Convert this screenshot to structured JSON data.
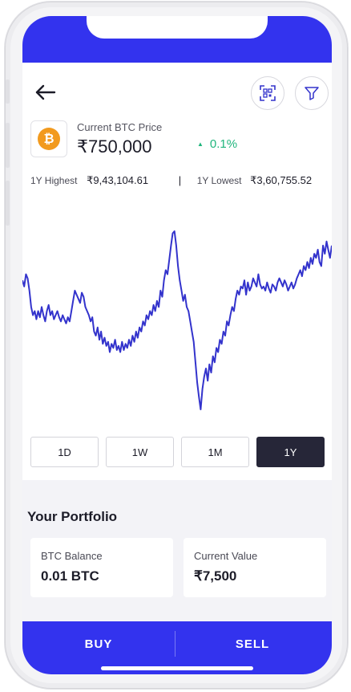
{
  "header": {
    "back_icon": "arrow-left-icon",
    "scan_icon": "qr-scan-icon",
    "filter_icon": "filter-icon"
  },
  "price": {
    "coin_symbol": "₿",
    "label": "Current BTC Price",
    "value": "₹750,000",
    "change": "0.1%",
    "change_color": "#1fb57c"
  },
  "stats": {
    "high_label": "1Y Highest",
    "high_value": "₹9,43,104.61",
    "separator": "|",
    "low_label": "1Y Lowest",
    "low_value": "₹3,60,755.52"
  },
  "chart_data": {
    "type": "line",
    "title": "",
    "xlabel": "",
    "ylabel": "",
    "grid": false,
    "color": "#3333cc",
    "values": [
      75,
      72,
      78,
      76,
      70,
      62,
      58,
      60,
      56,
      60,
      57,
      62,
      58,
      55,
      60,
      63,
      58,
      60,
      56,
      58,
      60,
      57,
      55,
      58,
      56,
      54,
      57,
      55,
      60,
      65,
      70,
      68,
      66,
      64,
      69,
      67,
      62,
      60,
      58,
      55,
      57,
      50,
      48,
      52,
      46,
      50,
      44,
      47,
      43,
      45,
      40,
      44,
      42,
      46,
      41,
      43,
      40,
      45,
      41,
      44,
      42,
      46,
      43,
      48,
      45,
      50,
      47,
      52,
      50,
      55,
      53,
      58,
      56,
      60,
      58,
      63,
      60,
      65,
      62,
      70,
      67,
      75,
      80,
      78,
      85,
      92,
      98,
      99,
      92,
      82,
      75,
      70,
      65,
      68,
      62,
      60,
      55,
      50,
      45,
      35,
      25,
      18,
      12,
      22,
      28,
      32,
      26,
      34,
      30,
      38,
      35,
      42,
      40,
      46,
      44,
      50,
      48,
      55,
      53,
      58,
      62,
      60,
      66,
      70,
      68,
      72,
      71,
      75,
      68,
      74,
      70,
      72,
      76,
      74,
      72,
      78,
      73,
      71,
      72,
      70,
      74,
      71,
      69,
      73,
      72,
      70,
      74,
      76,
      74,
      72,
      75,
      73,
      70,
      72,
      74,
      71,
      73,
      76,
      78,
      80,
      77,
      82,
      80,
      84,
      81,
      86,
      83,
      88,
      86,
      90,
      84,
      82,
      92,
      88,
      94,
      90,
      86,
      92
    ],
    "line_color": "#3333cc"
  },
  "ranges": {
    "items": [
      "1D",
      "1W",
      "1M",
      "1Y"
    ],
    "active": "1Y",
    "active_color": "#262638"
  },
  "portfolio": {
    "title": "Your Portfolio",
    "balance_label": "BTC Balance",
    "balance_value": "0.01 BTC",
    "current_label": "Current Value",
    "current_value": "₹7,500"
  },
  "actions": {
    "buy_label": "BUY",
    "sell_label": "SELL",
    "brand_color": "#3333ee"
  }
}
